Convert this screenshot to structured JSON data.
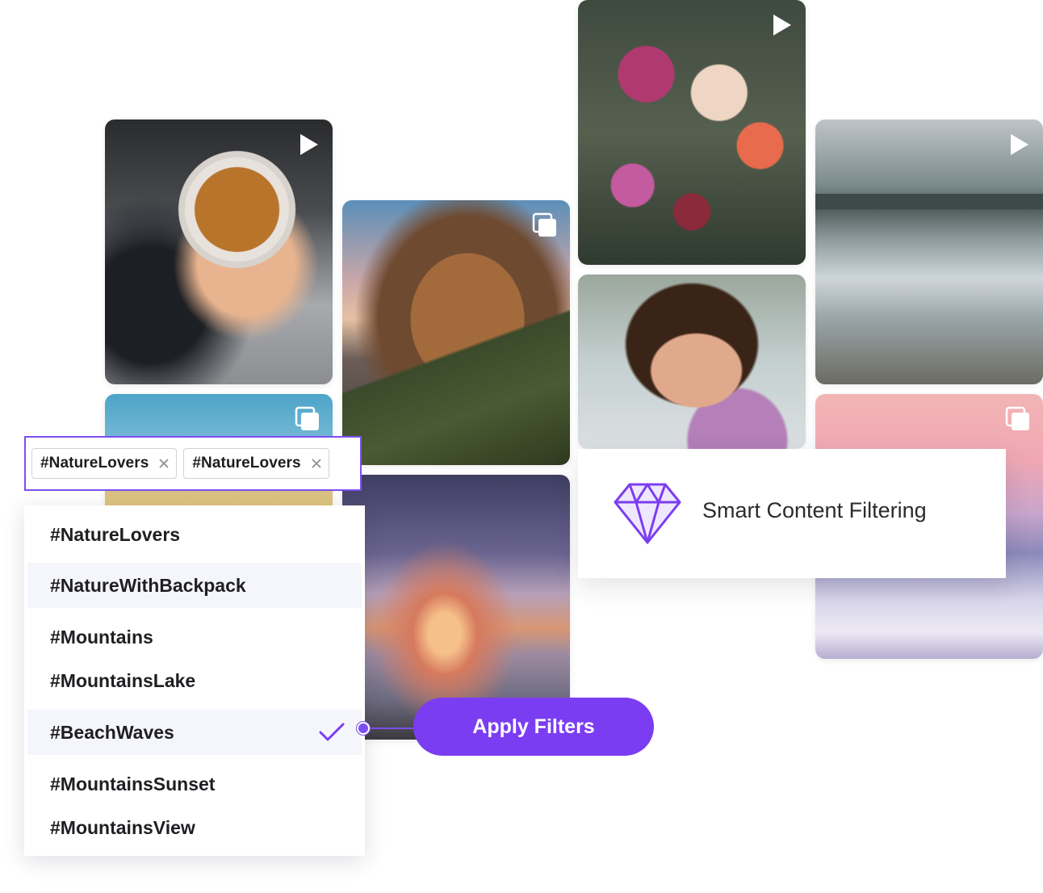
{
  "tags_input": {
    "chips": [
      {
        "label": "#NatureLovers"
      },
      {
        "label": "#NatureLovers"
      }
    ]
  },
  "dropdown": {
    "options": [
      {
        "label": "#NatureLovers",
        "highlighted": false,
        "selected": false
      },
      {
        "label": "#NatureWithBackpack",
        "highlighted": true,
        "selected": false
      },
      {
        "label": "#Mountains",
        "highlighted": false,
        "selected": false
      },
      {
        "label": "#MountainsLake",
        "highlighted": false,
        "selected": false
      },
      {
        "label": "#BeachWaves",
        "highlighted": true,
        "selected": true
      },
      {
        "label": "#MountainsSunset",
        "highlighted": false,
        "selected": false
      },
      {
        "label": "#MountainsView",
        "highlighted": false,
        "selected": false
      }
    ]
  },
  "apply_button": {
    "label": "Apply Filters"
  },
  "feature_card": {
    "title": "Smart Content Filtering",
    "icon": "diamond-icon"
  },
  "gallery": {
    "tiles": [
      {
        "name": "coffee-latte-photo",
        "badge": "play-icon"
      },
      {
        "name": "beach-photo",
        "badge": "gallery-icon"
      },
      {
        "name": "mountain-peak-photo",
        "badge": "gallery-icon"
      },
      {
        "name": "sunset-sea-photo",
        "badge": "none"
      },
      {
        "name": "flowers-photo",
        "badge": "play-icon"
      },
      {
        "name": "smiling-woman-photo",
        "badge": "none"
      },
      {
        "name": "mountain-lake-photo",
        "badge": "play-icon"
      },
      {
        "name": "pink-sky-clouds-photo",
        "badge": "gallery-icon"
      }
    ]
  },
  "colors": {
    "accent": "#7b3df2",
    "border_accent": "#7b4ff0",
    "highlight": "#f5f6fb"
  }
}
